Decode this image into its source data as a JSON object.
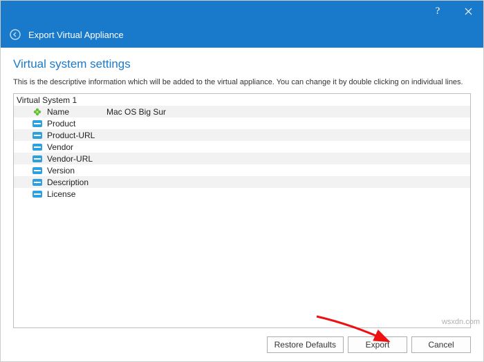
{
  "titlebar": {
    "help": "?",
    "close": "×"
  },
  "header": {
    "title": "Export Virtual Appliance"
  },
  "section": {
    "title": "Virtual system settings",
    "description": "This is the descriptive information which will be added to the virtual appliance. You can change it by double clicking on individual lines."
  },
  "group_label": "Virtual System 1",
  "rows": [
    {
      "label": "Name",
      "value": "Mac OS Big Sur",
      "icon": "name"
    },
    {
      "label": "Product",
      "value": "",
      "icon": "field"
    },
    {
      "label": "Product-URL",
      "value": "",
      "icon": "field"
    },
    {
      "label": "Vendor",
      "value": "",
      "icon": "field"
    },
    {
      "label": "Vendor-URL",
      "value": "",
      "icon": "field"
    },
    {
      "label": "Version",
      "value": "",
      "icon": "field"
    },
    {
      "label": "Description",
      "value": "",
      "icon": "field"
    },
    {
      "label": "License",
      "value": "",
      "icon": "field"
    }
  ],
  "buttons": {
    "restore": "Restore Defaults",
    "export": "Export",
    "cancel": "Cancel"
  },
  "watermark": "wsxdn.com"
}
